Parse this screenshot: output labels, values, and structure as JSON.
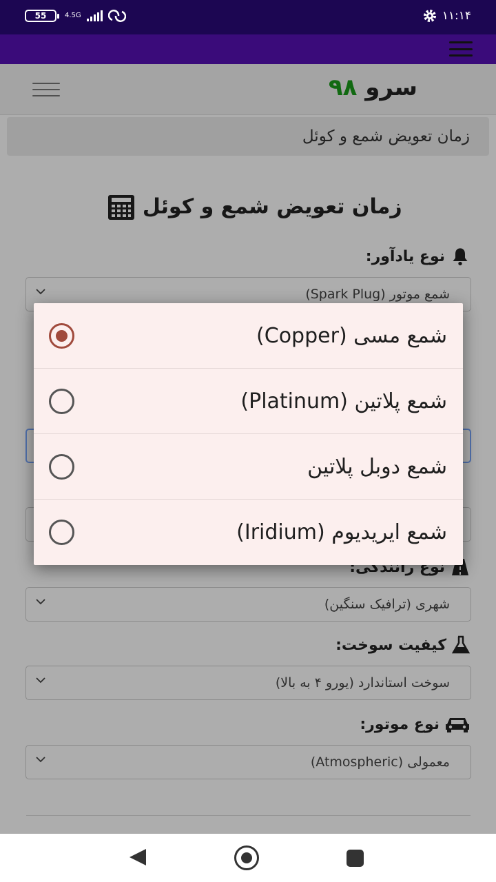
{
  "status_bar": {
    "battery": "55",
    "network": "4.5G",
    "time": "۱۱:۱۴"
  },
  "header": {
    "brand_name": "سرو",
    "brand_number": "۹۸"
  },
  "breadcrumb": "زمان تعویض شمع و کوئل",
  "page_title": "زمان تعویض شمع و کوئل",
  "form": {
    "reminder_type": {
      "label": "نوع یادآور:",
      "value": "شمع موتور (Spark Plug)"
    },
    "driving_type": {
      "label": "نوع رانندگی:",
      "value": "شهری (ترافیک سنگین)"
    },
    "fuel_quality": {
      "label": "کیفیت سوخت:",
      "value": "سوخت استاندارد (یورو ۴ به بالا)"
    },
    "engine_type": {
      "label": "نوع موتور:",
      "value": "معمولی (Atmospheric)"
    }
  },
  "dialog": {
    "options": [
      {
        "label": "شمع مسی (Copper)",
        "selected": true
      },
      {
        "label": "شمع پلاتین (Platinum)",
        "selected": false
      },
      {
        "label": "شمع دوبل پلاتین",
        "selected": false
      },
      {
        "label": "شمع ایریدیوم (Iridium)",
        "selected": false
      }
    ]
  },
  "colors": {
    "status_bar": "#1c0652",
    "app_bar": "#3a0b7a",
    "brand_green": "#1a9b1a",
    "radio_accent": "#a04a3c",
    "dialog_bg": "#fcefee"
  },
  "icons": [
    "settings-icon",
    "menu-icon",
    "calculator-icon",
    "bell-icon",
    "car-icon",
    "flask-icon",
    "chevron-down-icon"
  ]
}
